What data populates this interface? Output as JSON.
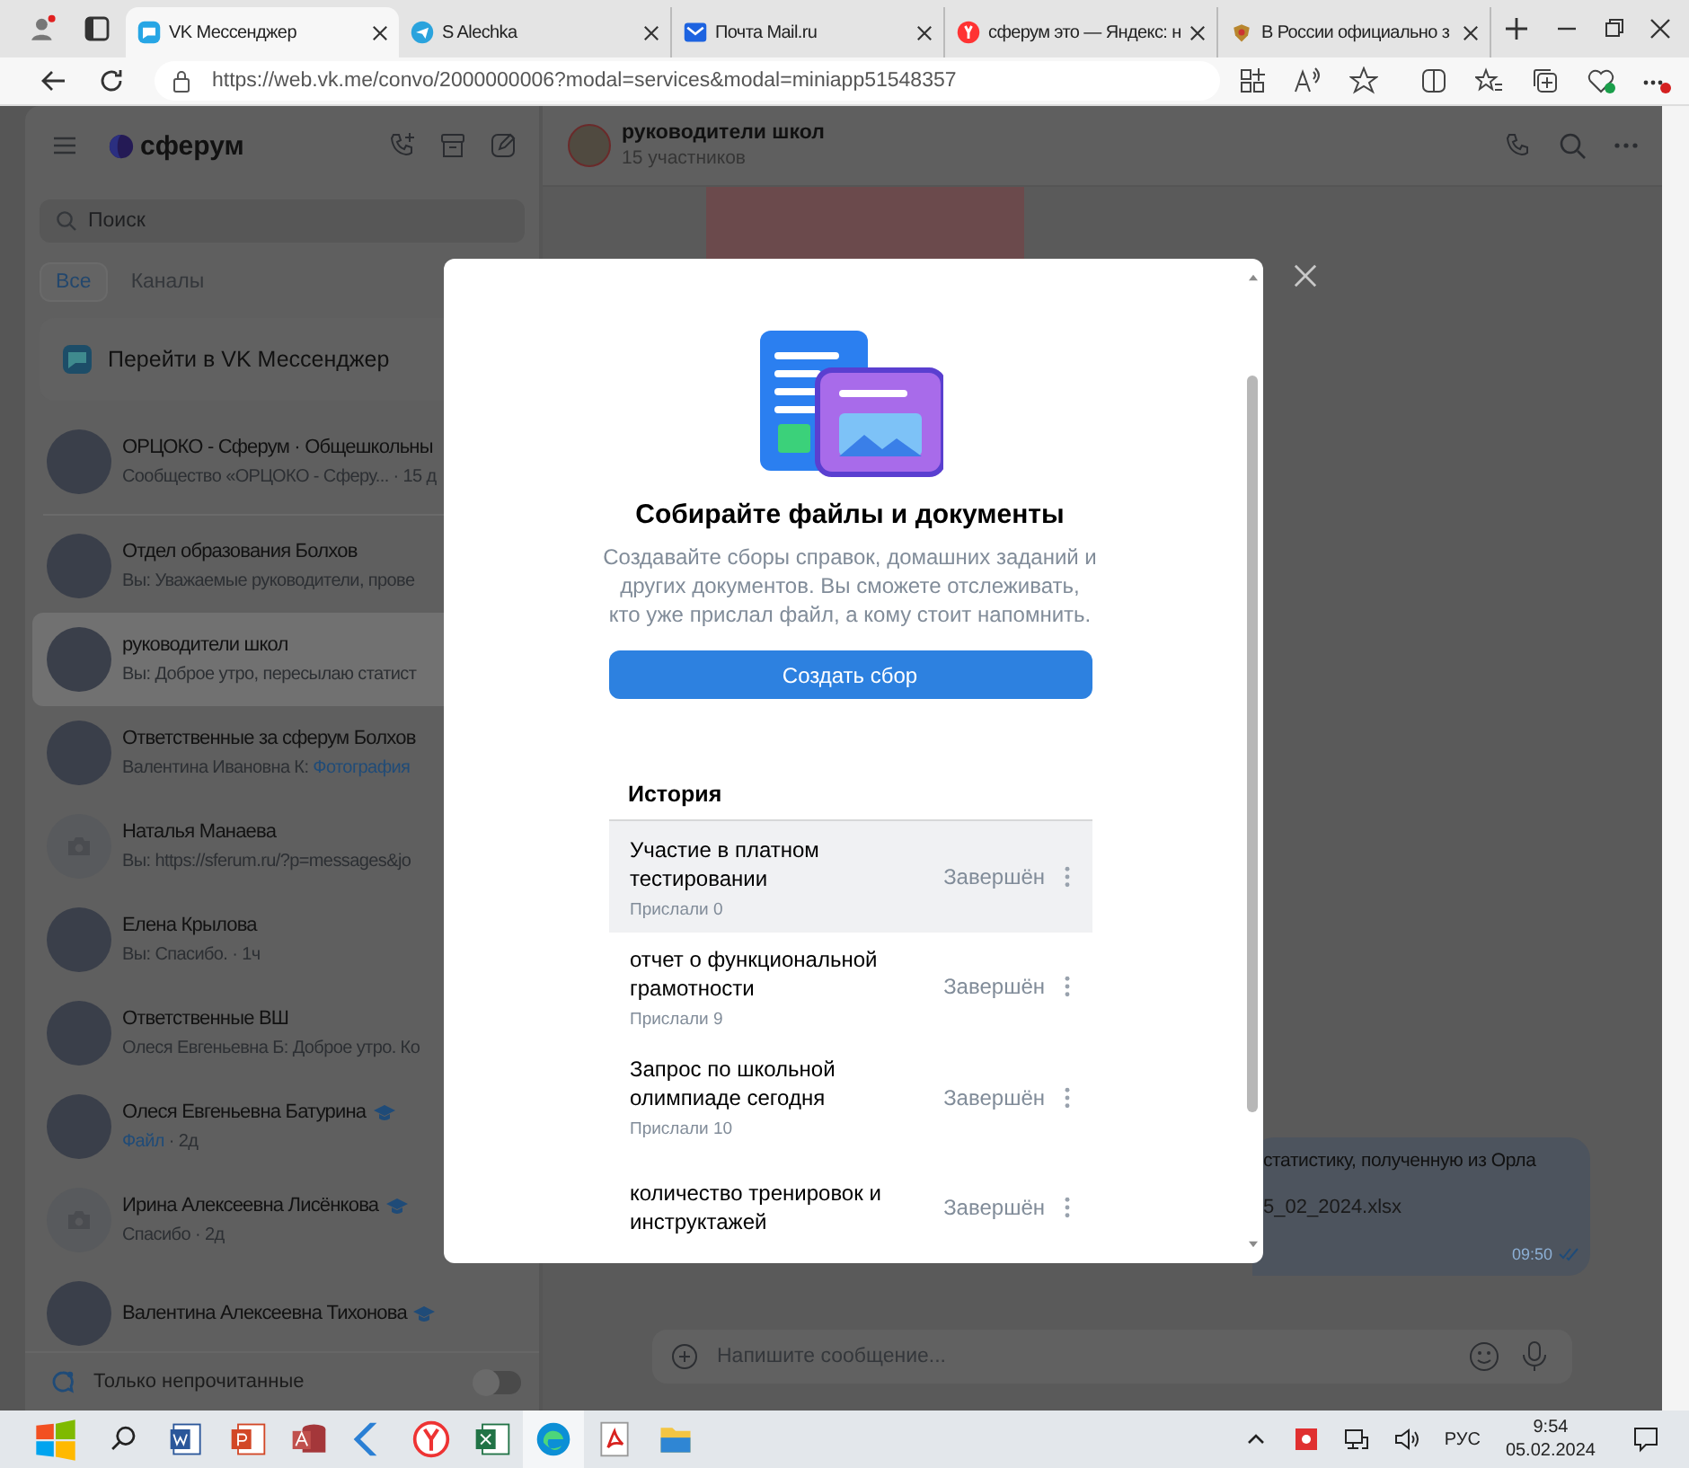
{
  "browser": {
    "tabs": [
      {
        "kind": "vk",
        "title": "VK Мессенджер",
        "selected": true
      },
      {
        "kind": "telegram",
        "title": "S Alechka",
        "selected": false
      },
      {
        "kind": "mail",
        "title": "Почта Mail.ru",
        "selected": false
      },
      {
        "kind": "yandex",
        "title": "сферум это — Яндекс: н",
        "selected": false
      },
      {
        "kind": "emblem",
        "title": "В России официально з",
        "selected": false
      }
    ],
    "url": "https://web.vk.me/convo/2000000006?modal=services&modal=miniapp51548357"
  },
  "sidebar": {
    "logo": "сферум",
    "search": {
      "placeholder": "Поиск"
    },
    "filters": [
      {
        "label": "Все",
        "selected": true
      },
      {
        "label": "Каналы",
        "selected": false
      }
    ],
    "banner": "Перейти в VK Мессенджер",
    "chats": [
      {
        "kind": "photo",
        "name": "ОРЦОКО - Сферум · Общешкольны",
        "verified": false,
        "selected": false,
        "preview": [
          {
            "kind": "text",
            "text": "Сообщество «ОРЦОКО - Сферу... · 15 д"
          }
        ]
      },
      {
        "kind": "photo",
        "name": "Отдел образования Болхов",
        "verified": false,
        "selected": false,
        "preview": [
          {
            "kind": "text",
            "text": "Вы: Уважаемые руководители, прове"
          }
        ]
      },
      {
        "kind": "photo",
        "name": "руководители школ",
        "verified": false,
        "selected": true,
        "preview": [
          {
            "kind": "text",
            "text": "Вы: Доброе утро, пересылаю статист"
          }
        ]
      },
      {
        "kind": "photo",
        "name": "Ответственные за сферум Болхов",
        "verified": false,
        "selected": false,
        "preview": [
          {
            "kind": "text",
            "text": "Валентина Ивановна К: "
          },
          {
            "kind": "attachment",
            "text": "Фотография"
          }
        ]
      },
      {
        "kind": "placeholder",
        "name": "Наталья Манаева",
        "verified": false,
        "selected": false,
        "preview": [
          {
            "kind": "text",
            "text": "Вы: https://sferum.ru/?p=messages&jo"
          }
        ]
      },
      {
        "kind": "photo",
        "name": "Елена Крылова",
        "verified": false,
        "selected": false,
        "preview": [
          {
            "kind": "text",
            "text": "Вы: Спасибо. · 1ч"
          }
        ]
      },
      {
        "kind": "photo",
        "name": "Ответственные ВШ",
        "verified": false,
        "selected": false,
        "preview": [
          {
            "kind": "text",
            "text": "Олеся Евгеньевна Б: Доброе утро. Ко"
          }
        ]
      },
      {
        "kind": "photo",
        "name": "Олеся Евгеньевна Батурина",
        "verified": true,
        "selected": false,
        "preview": [
          {
            "kind": "attachment",
            "text": "Файл"
          },
          {
            "kind": "text",
            "text": " · 2д"
          }
        ]
      },
      {
        "kind": "placeholder",
        "name": "Ирина Алексеевна Лисёнкова",
        "verified": true,
        "selected": false,
        "preview": [
          {
            "kind": "text",
            "text": "Спасибо · 2д"
          }
        ]
      },
      {
        "kind": "photo",
        "name": "Валентина Алексеевна Тихонова",
        "verified": true,
        "selected": false
      }
    ],
    "unread_filter": {
      "label": "Только непрочитанные",
      "on": false
    }
  },
  "conversation": {
    "title": "руководители школ",
    "subtitle": "15 участников",
    "message": {
      "text": "статистику, полученную из Орла",
      "file": "5_02_2024.xlsx",
      "time": "09:50"
    },
    "composer": {
      "placeholder": "Напишите сообщение..."
    }
  },
  "modal": {
    "title": "Собирайте файлы и документы",
    "description": "Создавайте сборы справок, домашних заданий и других документов. Вы сможете отслеживать, кто уже прислал файл, а кому стоит напомнить.",
    "button": "Создать сбор",
    "history_title": "История",
    "history": [
      {
        "title": "Участие в платном тестировании",
        "sent": "Прислали 0",
        "status": "Завершён",
        "hovered": true
      },
      {
        "title": "отчет о функциональной грамотности",
        "sent": "Прислали 9",
        "status": "Завершён",
        "hovered": false
      },
      {
        "title": "Запрос по школьной олимпиаде сегодня",
        "sent": "Прислали 10",
        "status": "Завершён",
        "hovered": false
      },
      {
        "title": "количество тренировок и инструктажей",
        "status": "Завершён",
        "hovered": false
      }
    ]
  },
  "taskbar": {
    "apps": [
      {
        "kind": "word",
        "active": false
      },
      {
        "kind": "powerpoint",
        "active": false
      },
      {
        "kind": "access",
        "active": false
      },
      {
        "kind": "arrow",
        "active": false
      },
      {
        "kind": "yandex",
        "active": false
      },
      {
        "kind": "excel",
        "active": false
      },
      {
        "kind": "edge",
        "active": true
      },
      {
        "kind": "pdf",
        "active": false
      },
      {
        "kind": "folder",
        "active": false
      }
    ],
    "language": "РУС",
    "time": "9:54",
    "date": "05.02.2024"
  }
}
